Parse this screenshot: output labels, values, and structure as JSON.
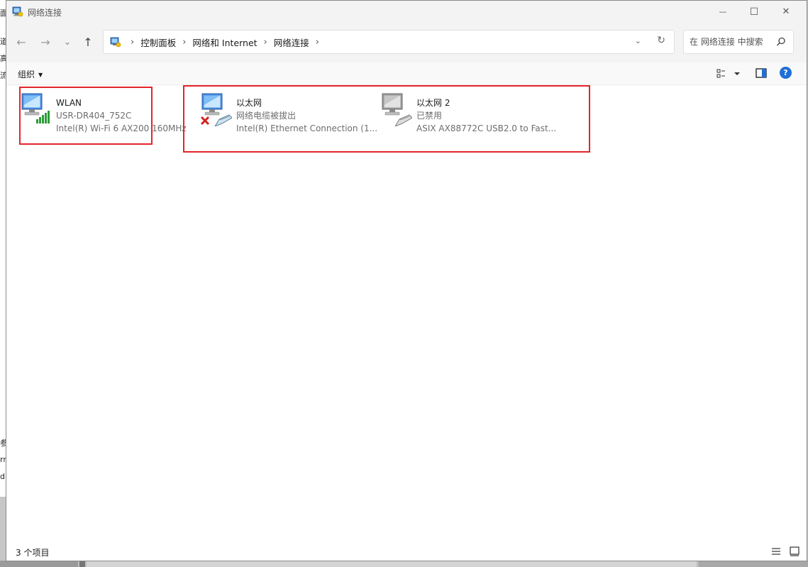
{
  "background_window": {
    "chars": [
      "面",
      "道",
      "高",
      "流",
      "参",
      "rr",
      "d"
    ]
  },
  "window": {
    "title": "网络连接",
    "minimize_glyph": "—",
    "maximize_glyph": "☐",
    "close_glyph": "✕"
  },
  "nav": {
    "back_glyph": "←",
    "forward_glyph": "→",
    "recent_glyph": "⌄",
    "up_glyph": "↑",
    "breadcrumbs": [
      "控制面板",
      "网络和 Internet",
      "网络连接"
    ],
    "separator": "›",
    "refresh_glyph": "↻",
    "dropdown_glyph": "⌄",
    "search_placeholder": "在 网络连接 中搜索"
  },
  "commandbar": {
    "organize_label": "组织",
    "organize_caret": "▼",
    "help_label": "?"
  },
  "connections": [
    {
      "name": "WLAN",
      "status": "USR-DR404_752C",
      "device": "Intel(R) Wi-Fi 6 AX200 160MHz",
      "icon": "wifi-connection-icon"
    },
    {
      "name": "以太网",
      "status": "网络电缆被拔出",
      "device": "Intel(R) Ethernet Connection (1...",
      "icon": "ethernet-disconnected-icon"
    },
    {
      "name": "以太网 2",
      "status": "已禁用",
      "device": "ASIX AX88772C USB2.0 to Fast...",
      "icon": "ethernet-disabled-icon"
    }
  ],
  "status": {
    "item_count": "3 个项目"
  },
  "colors": {
    "highlight": "#e3252b",
    "accent": "#1f6fd6"
  }
}
